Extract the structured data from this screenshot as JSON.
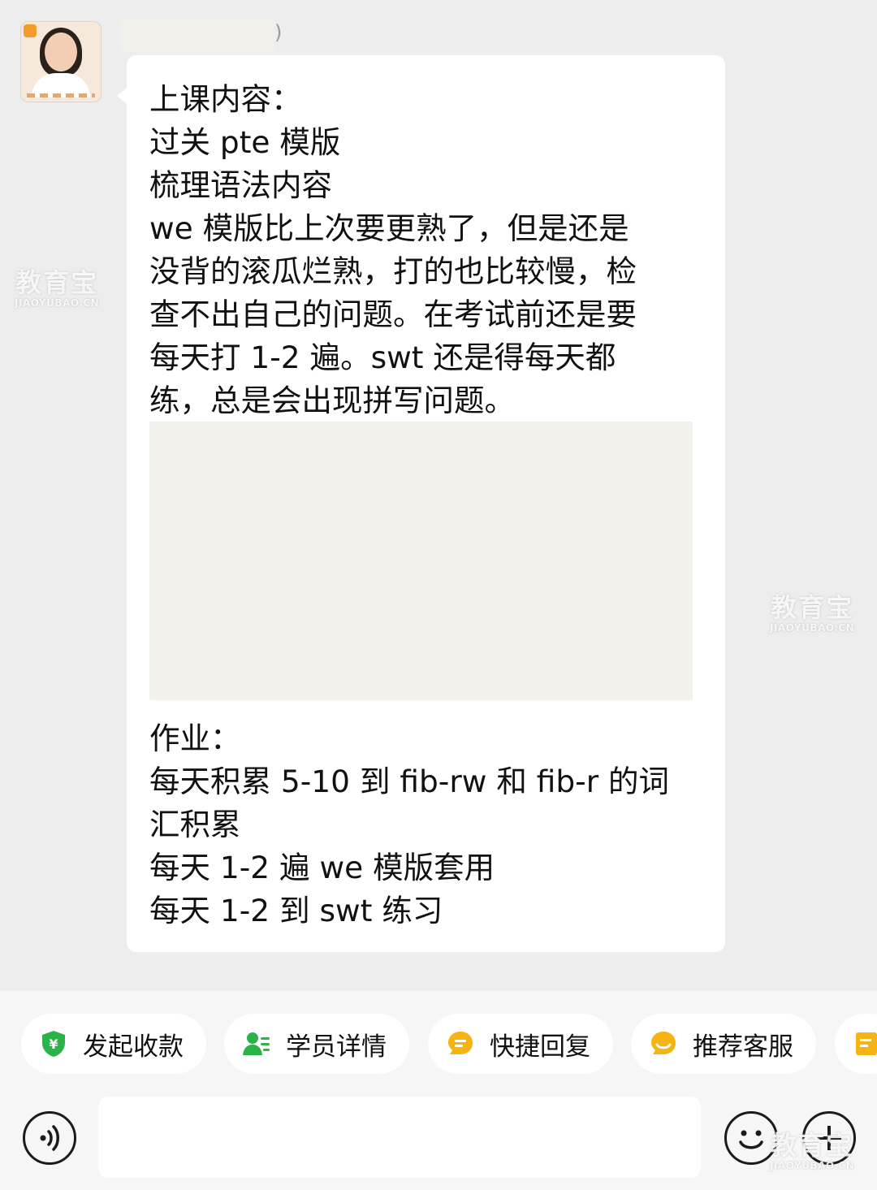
{
  "conversation": {
    "message": {
      "lines_top": [
        "上课内容：",
        "过关 pte 模版",
        "梳理语法内容",
        "we 模版比上次要更熟了，但是还是",
        "没背的滚瓜烂熟，打的也比较慢，检",
        "查不出自己的问题。在考试前还是要",
        "每天打 1-2 遍。swt 还是得每天都",
        "练，总是会出现拼写问题。"
      ],
      "lines_bottom": [
        "作业：",
        "每天积累 5-10 到 fib-rw 和 fib-r 的词",
        "汇积累",
        "每天 1-2 遍 we 模版套用",
        "每天 1-2 到 swt 练习"
      ]
    }
  },
  "watermark": {
    "text": "教育宝",
    "subtext": "JIAOYUBAO.CN"
  },
  "quick_actions": [
    {
      "label": "发起收款",
      "icon": "payment-shield-icon",
      "color": "#2bb34a"
    },
    {
      "label": "学员详情",
      "icon": "student-profile-icon",
      "color": "#2bb34a"
    },
    {
      "label": "快捷回复",
      "icon": "quick-reply-icon",
      "color": "#f5b414"
    },
    {
      "label": "推荐客服",
      "icon": "recommend-service-icon",
      "color": "#f5b414"
    },
    {
      "label": "",
      "icon": "note-icon",
      "color": "#f5b414"
    }
  ],
  "input": {
    "placeholder": "",
    "voice_icon": "voice-icon",
    "emoji_icon": "emoji-icon",
    "plus_icon": "plus-icon"
  }
}
